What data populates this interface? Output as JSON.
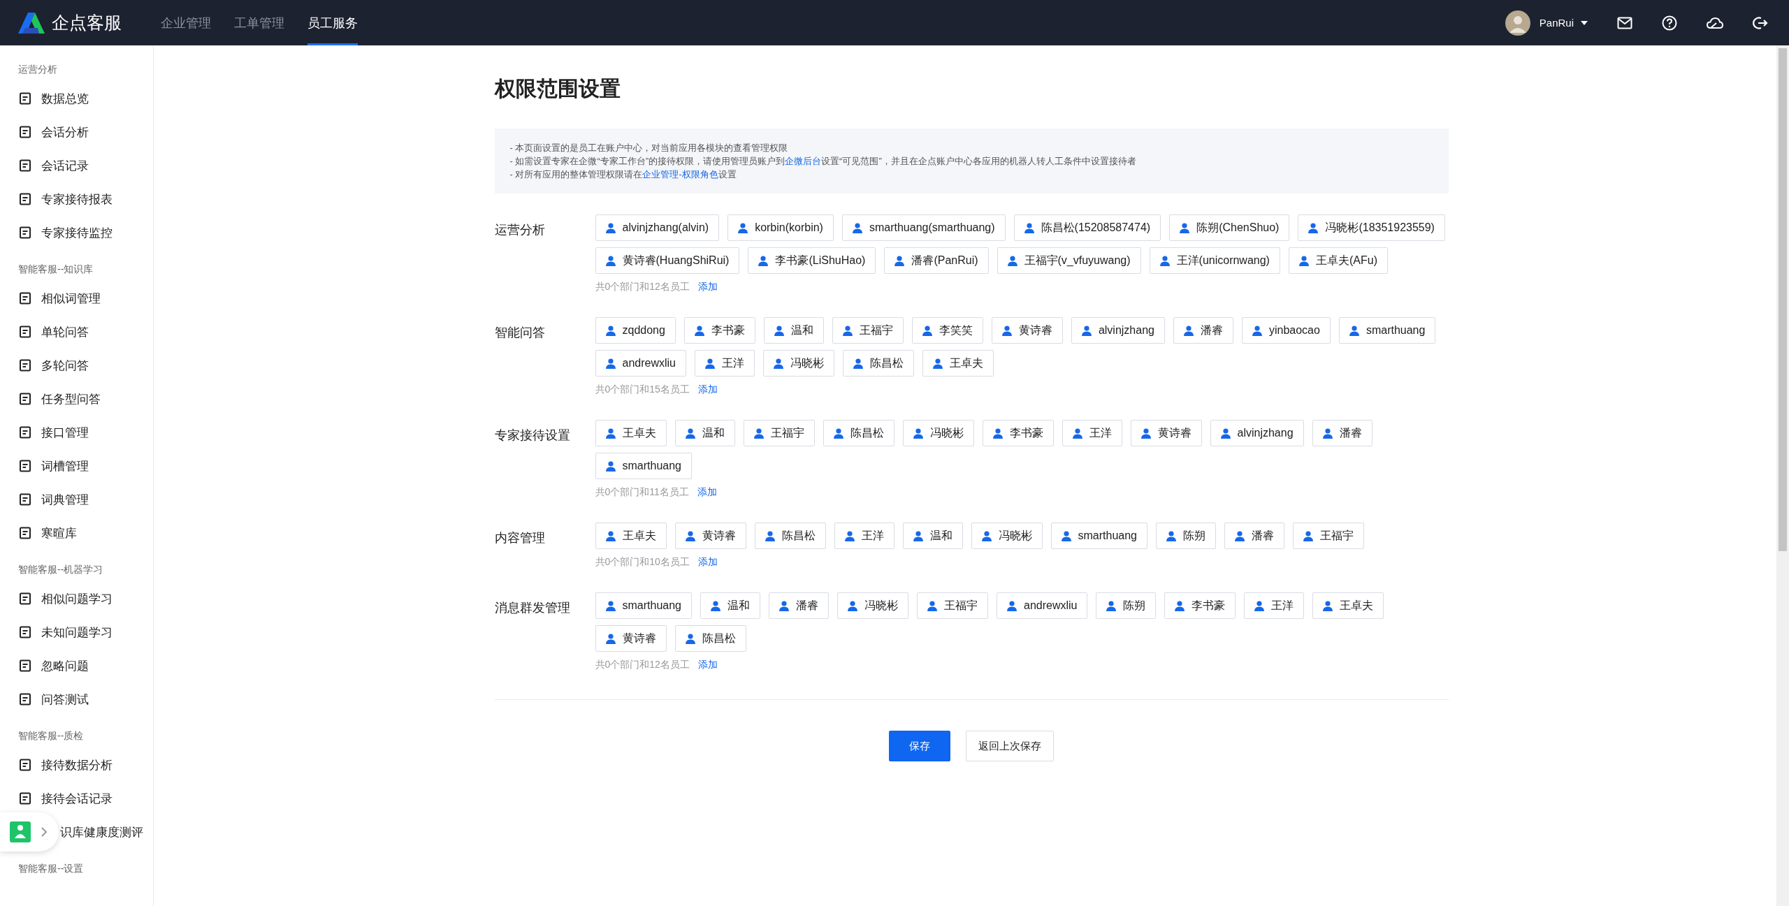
{
  "header": {
    "logo": "企点客服",
    "nav": [
      {
        "label": "企业管理",
        "selected": false
      },
      {
        "label": "工单管理",
        "selected": false
      },
      {
        "label": "员工服务",
        "selected": true
      }
    ],
    "user": {
      "name": "PanRui"
    }
  },
  "sidebar": {
    "sections": [
      {
        "title": "运营分析",
        "items": [
          {
            "label": "数据总览"
          },
          {
            "label": "会话分析"
          },
          {
            "label": "会话记录"
          },
          {
            "label": "专家接待报表"
          },
          {
            "label": "专家接待监控"
          }
        ]
      },
      {
        "title": "智能客服--知识库",
        "items": [
          {
            "label": "相似词管理"
          },
          {
            "label": "单轮问答"
          },
          {
            "label": "多轮问答"
          },
          {
            "label": "任务型问答"
          },
          {
            "label": "接口管理"
          },
          {
            "label": "词槽管理"
          },
          {
            "label": "词典管理"
          },
          {
            "label": "寒暄库"
          }
        ]
      },
      {
        "title": "智能客服--机器学习",
        "items": [
          {
            "label": "相似问题学习"
          },
          {
            "label": "未知问题学习"
          },
          {
            "label": "忽略问题"
          },
          {
            "label": "问答测试"
          }
        ]
      },
      {
        "title": "智能客服--质检",
        "items": [
          {
            "label": "接待数据分析"
          },
          {
            "label": "接待会话记录"
          },
          {
            "label": "识库健康度测评",
            "kind": "covered"
          }
        ]
      },
      {
        "title": "智能客服--设置"
      }
    ]
  },
  "page": {
    "title": "权限范围设置",
    "notice": [
      [
        {
          "kind": "text",
          "text": "- 本页面设置的是员工在账户中心，对当前应用各模块的查看管理权限"
        }
      ],
      [
        {
          "kind": "text",
          "text": "- 如需设置专家在企微“专家工作台”的接待权限，请使用管理员账户到"
        },
        {
          "kind": "link",
          "text": "企微后台"
        },
        {
          "kind": "text",
          "text": "设置“可见范围”，并且在企点账户中心各应用的机器人转人工条件中设置接待者"
        }
      ],
      [
        {
          "kind": "text",
          "text": "- 对所有应用的整体管理权限请在"
        },
        {
          "kind": "link",
          "text": "企业管理-权限角色"
        },
        {
          "kind": "text",
          "text": "设置"
        }
      ]
    ],
    "permissions": [
      {
        "label": "运营分析",
        "members": [
          "alvinjzhang(alvin)",
          "korbin(korbin)",
          "smarthuang(smarthuang)",
          "陈昌松(15208587474)",
          "陈朔(ChenShuo)",
          "冯晓彬(18351923559)",
          "黄诗睿(HuangShiRui)",
          "李书豪(LiShuHao)",
          "潘睿(PanRui)",
          "王福宇(v_vfuyuwang)",
          "王洋(unicornwang)",
          "王卓夫(AFu)"
        ],
        "summary": "共0个部门和12名员工",
        "action": "添加"
      },
      {
        "label": "智能问答",
        "members": [
          "zqddong",
          "李书豪",
          "温和",
          "王福宇",
          "李笑笑",
          "黄诗睿",
          "alvinjzhang",
          "潘睿",
          "yinbaocao",
          "smarthuang",
          "andrewxliu",
          "王洋",
          "冯晓彬",
          "陈昌松",
          "王卓夫"
        ],
        "summary": "共0个部门和15名员工",
        "action": "添加"
      },
      {
        "label": "专家接待设置",
        "members": [
          "王卓夫",
          "温和",
          "王福宇",
          "陈昌松",
          "冯晓彬",
          "李书豪",
          "王洋",
          "黄诗睿",
          "alvinjzhang",
          "潘睿",
          "smarthuang"
        ],
        "summary": "共0个部门和11名员工",
        "action": "添加"
      },
      {
        "label": "内容管理",
        "members": [
          "王卓夫",
          "黄诗睿",
          "陈昌松",
          "王洋",
          "温和",
          "冯晓彬",
          "smarthuang",
          "陈朔",
          "潘睿",
          "王福宇"
        ],
        "summary": "共0个部门和10名员工",
        "action": "添加"
      },
      {
        "label": "消息群发管理",
        "members": [
          "smarthuang",
          "温和",
          "潘睿",
          "冯晓彬",
          "王福宇",
          "andrewxliu",
          "陈朔",
          "李书豪",
          "王洋",
          "王卓夫",
          "黄诗睿",
          "陈昌松"
        ],
        "summary": "共0个部门和12名员工",
        "action": "添加"
      }
    ],
    "buttons": {
      "primary": "保存",
      "secondary": "返回上次保存"
    }
  }
}
